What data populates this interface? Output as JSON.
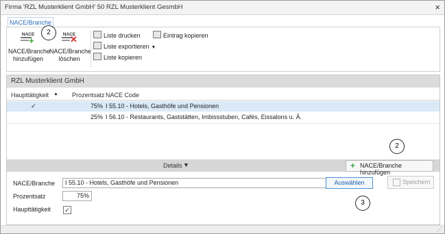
{
  "window": {
    "title": "Firma 'RZL Musterklient GmbH' 50 RZL Musterklient GesmbH",
    "close_glyph": "×"
  },
  "tab": {
    "label": "NACE/Branche"
  },
  "ribbon": {
    "add": {
      "icon_text": "NACE",
      "label_line1": "NACE/Branche",
      "label_line2": "hinzufügen"
    },
    "delete": {
      "icon_text": "NACE",
      "label_line1": "NACE/Branche",
      "label_line2": "löschen"
    },
    "print_label": "Liste drucken",
    "export_label": "Liste exportieren",
    "copy_list_label": "Liste kopieren",
    "copy_entry_label": "Eintrag kopieren"
  },
  "callouts": {
    "c1": "2",
    "c2": "2",
    "c3": "3"
  },
  "panel": {
    "title": "RZL Musterklient GmbH",
    "columns": {
      "main": "Haupttätigkeit",
      "percent": "Prozentsatz",
      "code": "NACE Code"
    },
    "rows": [
      {
        "main": "✓",
        "percent": "75%",
        "code": "I 55.10 - Hotels, Gasthöfe und Pensionen",
        "selected": true
      },
      {
        "main": "",
        "percent": "25%",
        "code": "I 56.10 - Restaurants, Gaststätten, Imbissstuben, Cafés, Eissalons u. Ä.",
        "selected": false
      }
    ]
  },
  "details": {
    "bar_label": "Details",
    "add_button_label": "NACE/Branche hinzufügen",
    "nace_label": "NACE/Branche",
    "nace_value": "I 55.10 - Hotels, Gasthöfe und Pensionen",
    "select_button": "Auswählen",
    "save_button": "Speichern",
    "percent_label": "Prozentsatz",
    "percent_value": "75%",
    "main_label": "Haupttätigkeit",
    "main_checked_glyph": "✓"
  },
  "colors": {
    "accent": "#2a6ebb",
    "add_green": "#3aa43a",
    "delete_red": "#d0302a",
    "selected_row": "#d9e9f7"
  }
}
